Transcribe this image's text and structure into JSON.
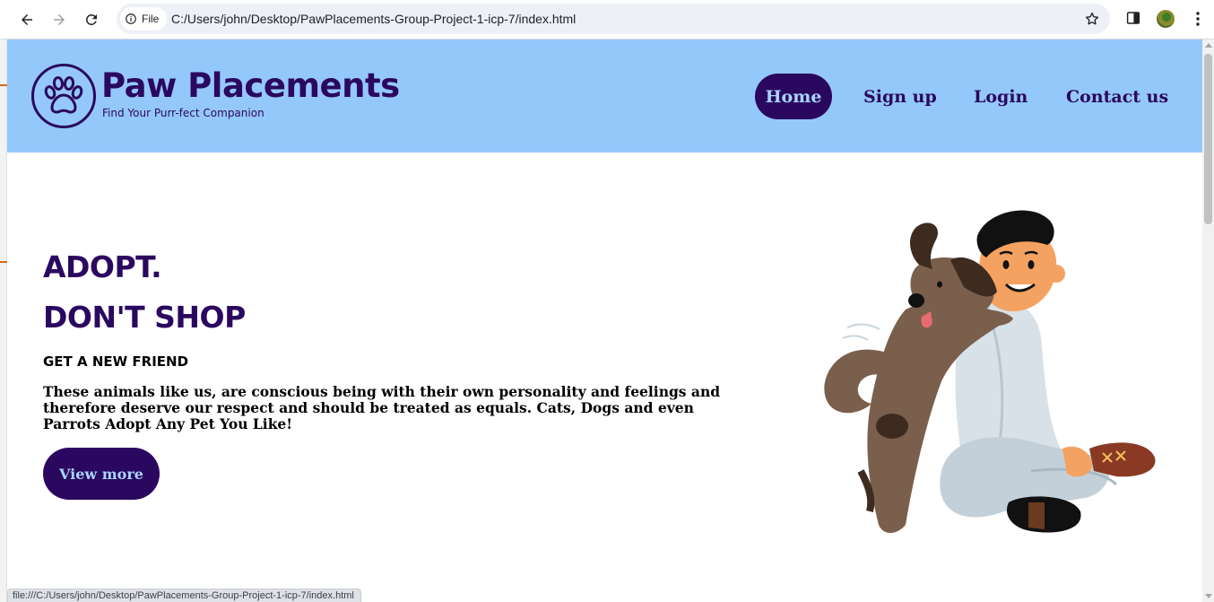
{
  "browser": {
    "site_chip_label": "File",
    "url": "C:/Users/john/Desktop/PawPlacements-Group-Project-1-icp-7/index.html",
    "status_url": "file:///C:/Users/john/Desktop/PawPlacements-Group-Project-1-icp-7/index.html",
    "icons": [
      "back-arrow-icon",
      "forward-arrow-icon",
      "reload-icon",
      "info-icon",
      "star-icon",
      "side-panel-icon",
      "profile-avatar",
      "kebab-menu-icon"
    ]
  },
  "header": {
    "brand_name": "Paw Placements",
    "tagline": "Find Your Purr-fect Companion",
    "logo_icon": "paw-icon",
    "nav": {
      "home": "Home",
      "signup": "Sign up",
      "login": "Login",
      "contact": "Contact us"
    }
  },
  "hero": {
    "title_line1": "ADOPT.",
    "title_line2": "DON'T SHOP",
    "subtitle": "GET A NEW FRIEND",
    "description": "These animals like us, are conscious being with their own personality and feelings and therefore deserve our respect and should be treated as equals. Cats, Dogs and even Parrots Adopt Any Pet You Like!",
    "cta_label": "View more",
    "illustration": "boy-hugging-dog-illustration"
  },
  "colors": {
    "header_bg": "#94c8fb",
    "brand_purple": "#2b0860",
    "active_nav_text": "#a9d4ff"
  }
}
